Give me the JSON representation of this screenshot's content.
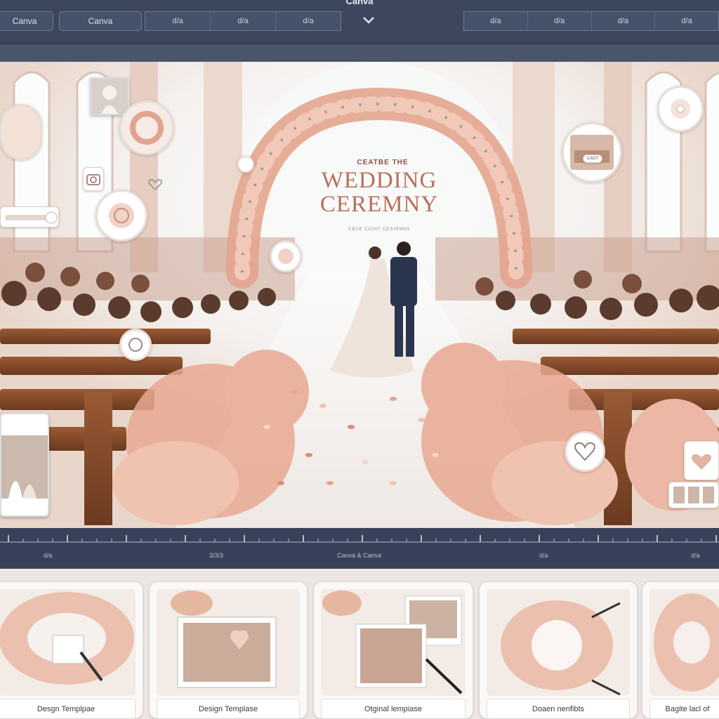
{
  "app": {
    "title": "Canva"
  },
  "toolbar": {
    "left_button": "Canva",
    "second_button": "Canva",
    "segment_a": [
      "d/a",
      "d/a",
      "d/a"
    ],
    "segment_b": [
      "d/a",
      "d/a",
      "d/a",
      "d/a"
    ]
  },
  "canvas": {
    "hero_subtitle": "CEATBE THE",
    "hero_title_line1": "WEDDING",
    "hero_title_line2": "CEREMNY",
    "hero_tagline": "CBIIE CUIHT CESIRNNS",
    "badge_text": "CAGT",
    "accent_color": "#b8705c",
    "petal_colors": [
      "#e8a48c",
      "#f2c2ae",
      "#d98c7a",
      "#f6d8c8"
    ]
  },
  "timeline": {
    "labels": [
      "d/a",
      "3/3/3",
      "Canva & Canva",
      "d/a",
      "d/a"
    ]
  },
  "templates": [
    {
      "label": "Desgn Templpae"
    },
    {
      "label": "Design Templase"
    },
    {
      "label": "Otginal lempiase"
    },
    {
      "label": "Doaen nenfibts"
    },
    {
      "label": "Bagite lacl of"
    }
  ]
}
